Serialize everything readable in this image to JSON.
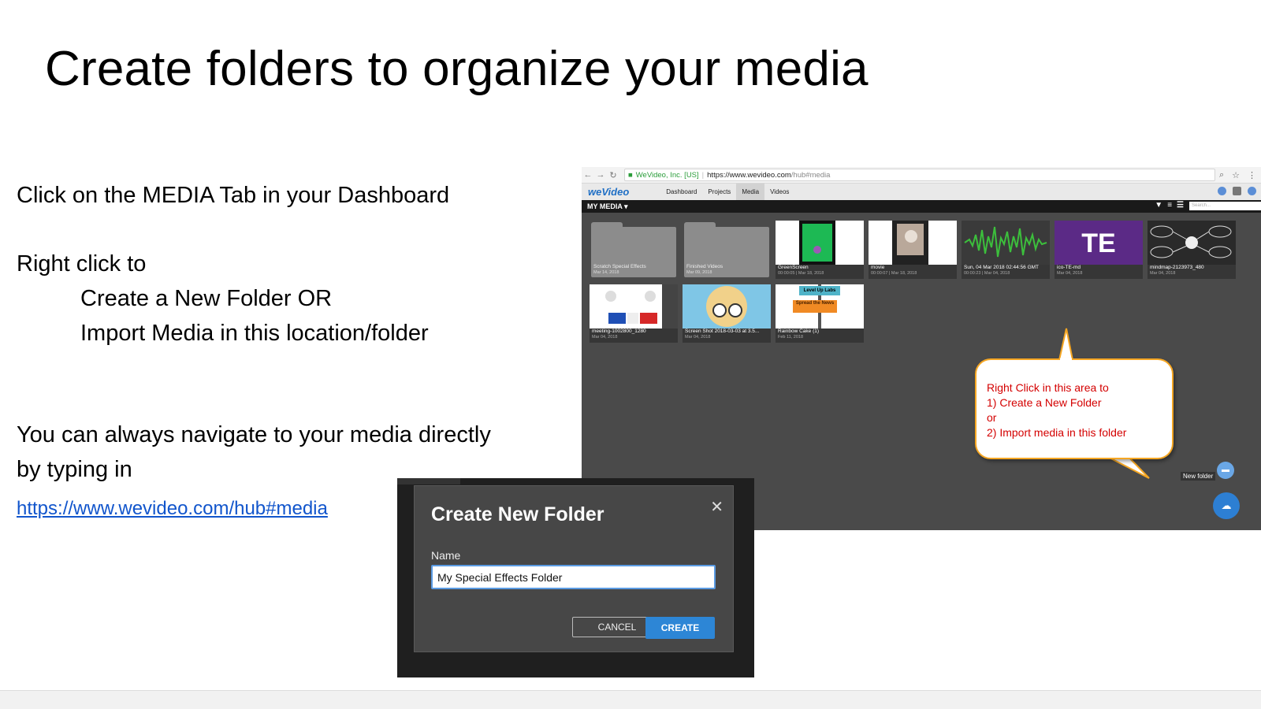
{
  "slide": {
    "title": "Create folders to organize your media",
    "line1": "Click on the MEDIA Tab in your Dashboard",
    "line2": "Right click  to",
    "line3": "Create a New Folder  OR",
    "line4": "Import Media in this location/folder",
    "line5": "You can always navigate to your media directly",
    "line6": "by typing in",
    "link": "https://www.wevideo.com/hub#media"
  },
  "browser": {
    "secure_label": "WeVideo, Inc. [US]",
    "url_host": "https://www.wevideo.com",
    "url_path": "/hub#media",
    "logo": "weVideo",
    "tabs": [
      "Dashboard",
      "Projects",
      "Media",
      "Videos"
    ],
    "active_tab": "Media",
    "media_header": "MY MEDIA ▾",
    "search_placeholder": "Search..."
  },
  "tiles": [
    {
      "title": "Scratch Special Effects",
      "sub": "Mar 14, 2018",
      "kind": "folder"
    },
    {
      "title": "Finished Videos",
      "sub": "Mar 09, 2018",
      "kind": "folder"
    },
    {
      "title": "GreenScreen",
      "sub": "00:00:05 | Mar 18, 2018",
      "kind": "green"
    },
    {
      "title": "movie",
      "sub": "00:00:07 | Mar 18, 2018",
      "kind": "photo"
    },
    {
      "title": "Sun, 04 Mar 2018 02:44:56 GMT",
      "sub": "00:00:23 | Mar 04, 2018",
      "kind": "audio"
    },
    {
      "title": "ico-TE-md",
      "sub": "Mar 04, 2018",
      "kind": "te"
    },
    {
      "title": "mindmap-2123973_480",
      "sub": "Mar 04, 2018",
      "kind": "mindmap"
    },
    {
      "title": "meeting-1002800_1280",
      "sub": "Mar 04, 2018",
      "kind": "meeting"
    },
    {
      "title": "Screen Shot 2018-03-03 at 3.5...",
      "sub": "Mar 04, 2018",
      "kind": "cartoon"
    },
    {
      "title": "Rainbow Cake (1)",
      "sub": "Feb 11, 2018",
      "kind": "sign"
    }
  ],
  "te_text": "TE",
  "sign_top": "Level Up Labs",
  "sign_bottom": "Spread the News",
  "callout": {
    "line1": "Right Click  in this area  to",
    "line2": "1) Create a New Folder",
    "line3": "or",
    "line4": "2) Import media in this folder"
  },
  "new_folder_label": "New folder",
  "dialog": {
    "title": "Create New Folder",
    "name_label": "Name",
    "name_value": "My Special Effects Folder",
    "cancel": "CANCEL",
    "create": "CREATE"
  },
  "colors": {
    "accent": "#2d86d6",
    "callout_border": "#f5a623",
    "callout_text": "#d40000",
    "green_screen": "#1db954",
    "te_purple": "#5b2a86"
  }
}
